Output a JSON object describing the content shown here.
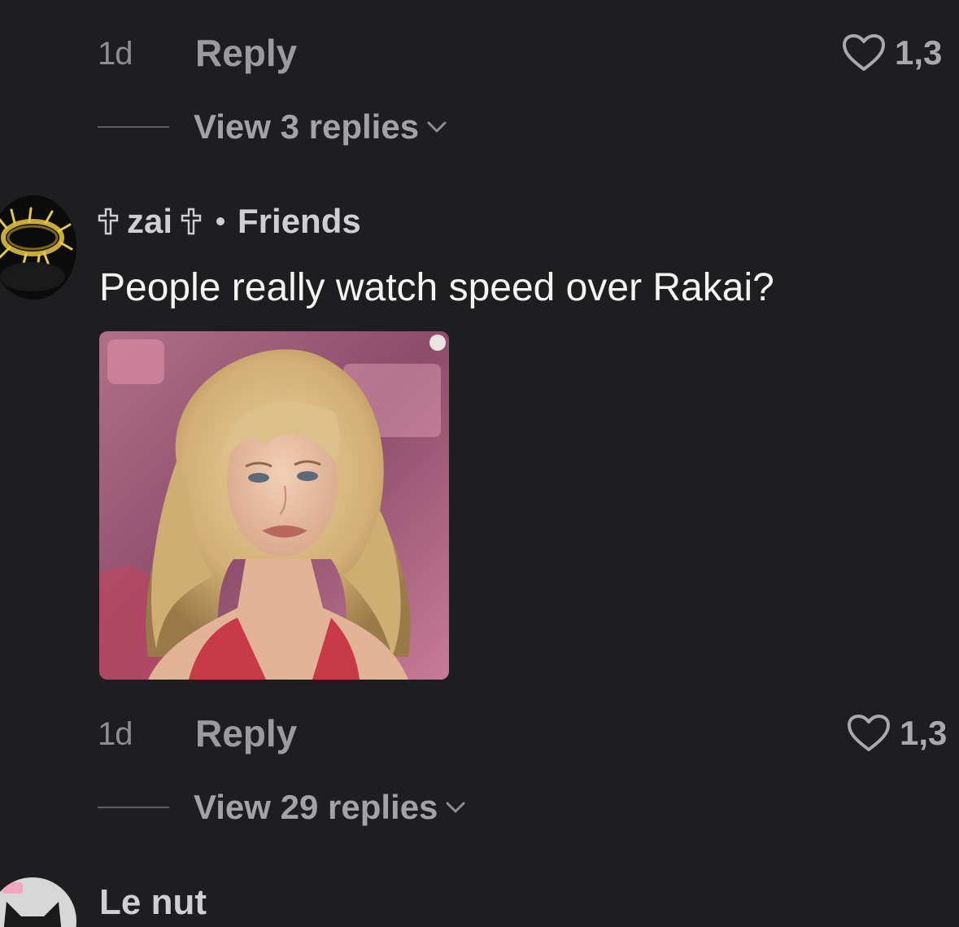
{
  "comment_prev": {
    "time": "1d",
    "reply_label": "Reply",
    "like_count": "1,3",
    "view_replies": "View 3 replies"
  },
  "comment_main": {
    "username": "zai",
    "badge": "Friends",
    "text": "People really watch speed over Rakai?",
    "time": "1d",
    "reply_label": "Reply",
    "like_count": "1,3",
    "view_replies": "View 29 replies"
  },
  "comment_next": {
    "username": "Le nut"
  },
  "icons": {
    "like": "heart-outline-icon",
    "expand": "chevron-down-icon",
    "name_decoration": "cross-icon"
  },
  "colors": {
    "background": "#1e1e20",
    "muted_text": "#8d8d92",
    "primary_text": "#f4f4f5"
  }
}
